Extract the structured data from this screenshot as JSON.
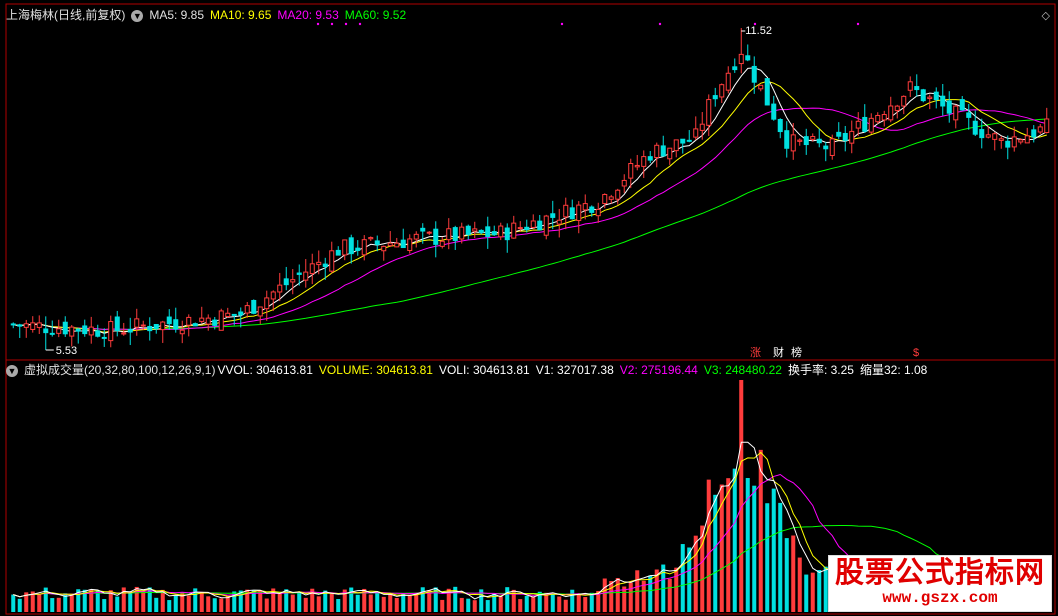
{
  "colors": {
    "background": "#000000",
    "up": "#ff3c3c",
    "down": "#00e0e0",
    "ma5": "#ffffff",
    "ma10": "#ffff00",
    "ma20": "#ff00ff",
    "ma60": "#00ff00",
    "v2": "#ff00ff",
    "v3": "#00ff00",
    "frame": "#b00000"
  },
  "header": {
    "title": "上海梅林(日线,前复权)",
    "ma5": "MA5: 9.85",
    "ma10": "MA10: 9.65",
    "ma20": "MA20: 9.53",
    "ma60": "MA60: 9.52",
    "menu_icon": "chevron-down-icon",
    "scroll_icon": "diamond-icon"
  },
  "volume_header": {
    "name": "虚拟成交量(20,32,80,100,12,26,9,1)",
    "vvol": "VVOL: 304613.81",
    "volume": "VOLUME: 304613.81",
    "voli": "VOLI: 304613.81",
    "v1": "V1: 327017.38",
    "v2": "V2: 275196.44",
    "v3": "V3: 248480.22",
    "turnover": "换手率: 3.25",
    "shrink": "缩量32: 1.08"
  },
  "info_markers": {
    "items": [
      "涨",
      "财",
      "榜"
    ],
    "dollar": "$"
  },
  "annotations": {
    "high": "11.52",
    "low": "5.53"
  },
  "watermark": {
    "title": "股票公式指标网",
    "url": "www.gszx.com"
  },
  "chart_data": [
    {
      "type": "candlestick",
      "title": "上海梅林(日线,前复权)",
      "ohlc_count": 160,
      "price_range": [
        5.53,
        11.52
      ],
      "marked_high": 11.52,
      "marked_low": 5.53,
      "close_path_keypoints": {
        "x_index": [
          0,
          15,
          35,
          50,
          62,
          75,
          90,
          98,
          108,
          118,
          126,
          138,
          152,
          160
        ],
        "close": [
          6.0,
          5.9,
          6.2,
          7.4,
          7.6,
          7.7,
          8.3,
          9.2,
          9.6,
          9.4,
          9.3,
          10.4,
          9.4,
          9.7
        ]
      },
      "spike": {
        "x_index": 112,
        "high": 11.52
      },
      "series": [
        {
          "name": "MA5",
          "last": 9.85
        },
        {
          "name": "MA10",
          "last": 9.65
        },
        {
          "name": "MA20",
          "last": 9.53
        },
        {
          "name": "MA60",
          "last": 9.52
        }
      ]
    },
    {
      "type": "bar",
      "title": "虚拟成交量(20,32,80,100,12,26,9,1)",
      "series": [
        {
          "name": "VVOL",
          "last": 304613.81
        },
        {
          "name": "V1",
          "last": 327017.38
        },
        {
          "name": "V2",
          "last": 275196.44
        },
        {
          "name": "V3",
          "last": 248480.22
        }
      ],
      "spike_index": 112
    }
  ]
}
